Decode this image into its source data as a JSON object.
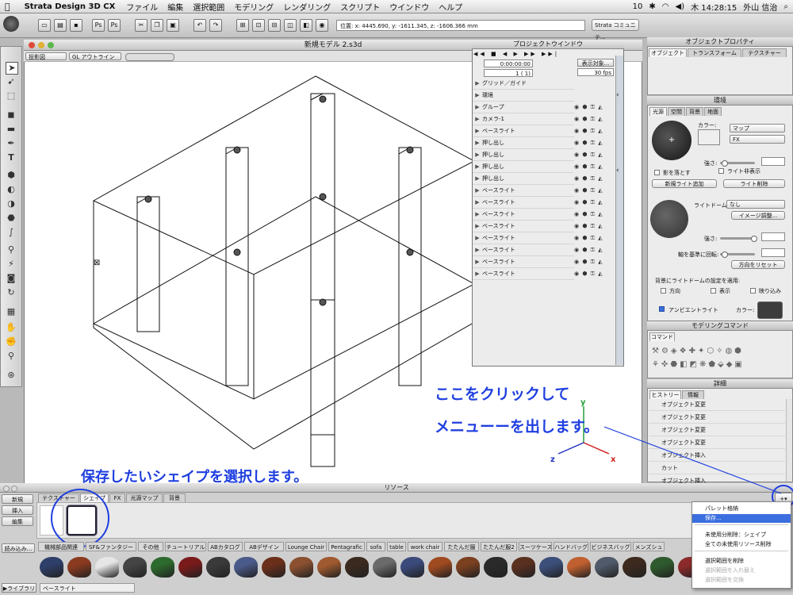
{
  "menubar": {
    "apple": "",
    "app_name": "Strata Design 3D CX",
    "menus": [
      "ファイル",
      "編集",
      "選択範囲",
      "モデリング",
      "レンダリング",
      "スクリプト",
      "ウインドウ",
      "ヘルプ"
    ],
    "status_number": "10",
    "clock": "木 14:28:15",
    "user": "外山 信治"
  },
  "toolbar": {
    "coords": "位置: x: 4445.690, y: -1611.345, z: -1606.366 mm",
    "strata_community": "Strata コミュニテ..."
  },
  "viewport": {
    "title": "新規モデル 2.s3d",
    "projection": "投影図",
    "render_mode": "GL アウトライン",
    "axis_y": "y",
    "axis_x": "x",
    "axis_z": "z"
  },
  "project_window": {
    "title": "プロジェクトウインドウ",
    "timecode": "0:00:00:00",
    "frame": "1 ( 1)",
    "display_objects": "表示対象...",
    "fps": "30 fps",
    "rows": [
      {
        "label": "グリッド／ガイド"
      },
      {
        "label": "環境"
      },
      {
        "label": "グループ"
      },
      {
        "label": "カメラ-1"
      },
      {
        "label": "ベースライト"
      },
      {
        "label": "押し出し"
      },
      {
        "label": "押し出し"
      },
      {
        "label": "押し出し"
      },
      {
        "label": "押し出し"
      },
      {
        "label": "ベースライト"
      },
      {
        "label": "ベースライト"
      },
      {
        "label": "ベースライト"
      },
      {
        "label": "ベースライト"
      },
      {
        "label": "ベースライト"
      },
      {
        "label": "ベースライト"
      },
      {
        "label": "ベースライト"
      },
      {
        "label": "ベースライト"
      }
    ]
  },
  "object_properties": {
    "title": "オブジェクトプロパティ",
    "tabs": [
      "オブジェクト",
      "トランスフォーム",
      "テクスチャー"
    ]
  },
  "environment": {
    "title": "環境",
    "tabs": [
      "光源",
      "空間",
      "背景",
      "地面"
    ],
    "light_plus": "+",
    "color_label": "カラー:",
    "map_dropdown": "マップ",
    "fx_dropdown": "FX",
    "strength_label": "強さ:",
    "shadow_check": "影を落とす",
    "light_hidden_check": "ライト非表示",
    "add_light_button": "新規ライト追加",
    "delete_light_button": "ライト削除",
    "light_dome_label": "ライトドーム:",
    "light_dome_value": "なし",
    "image_adjust_button": "イメージ調整...",
    "strength2_label": "強さ:",
    "rotate_label": "軸を基準に回転:",
    "reset_direction_button": "方向をリセット",
    "bg_dome_label": "背景にライトドームの設定を適用:",
    "direction_check": "方向",
    "display_check": "表示",
    "reflection_check": "映り込み",
    "ambient_check": "アンビエントライト",
    "ambient_color_label": "カラー:"
  },
  "modeling_commands": {
    "title": "モデリングコマンド",
    "tab": "コマンド"
  },
  "details": {
    "title": "詳細",
    "tabs": [
      "ヒストリー",
      "情報"
    ],
    "history": [
      "オブジェクト変更",
      "オブジェクト変更",
      "オブジェクト変更",
      "オブジェクト変更",
      "オブジェクト挿入",
      "カット",
      "オブジェクト挿入"
    ]
  },
  "resources": {
    "title": "リソース",
    "buttons": [
      "新規",
      "挿入",
      "編集"
    ],
    "load_button": "読み込み...",
    "tabs": [
      "テクスチャー",
      "シェイプ",
      "FX",
      "光源マップ",
      "背景"
    ],
    "library_tabs": [
      "機械部品関連",
      "SF&ファンタジー",
      "その他",
      "チュートリアル",
      "ABカタログ",
      "ABデザイン",
      "Lounge Chair",
      "Pentagrafic",
      "sofa",
      "table",
      "work chair",
      "たたんだ服",
      "たたんだ服2",
      "スーツケース",
      "ハンドバッグ",
      "ビジネスバッグ",
      "メンズシュ"
    ],
    "library_button": "▶ライブラリ",
    "footer_dropdown": "ベースライト",
    "shoe_colors": [
      "#2e3f6a",
      "#8a3a1e",
      "#e6e6e6",
      "#444444",
      "#2d6a2d",
      "#7a1a1a",
      "#3a3a3a",
      "#4a5a8a",
      "#6b2f1a",
      "#8a5030",
      "#a05a30",
      "#3b2a20",
      "#6a6a6a",
      "#3a4a7a",
      "#a04a20",
      "#7a4020",
      "#2a2a2a",
      "#5a3020",
      "#3c4f7a",
      "#c06030",
      "#505a6a",
      "#3d2a1f",
      "#2e5a2e",
      "#8a2a2a",
      "#405070",
      "#9a5a2a",
      "#333333",
      "#6a3a20"
    ]
  },
  "context_menu": {
    "items": [
      {
        "label": "パレット格納",
        "state": "normal"
      },
      {
        "label": "保存...",
        "state": "highlight"
      },
      {
        "label": "未使用分削除：シェイプ",
        "state": "normal"
      },
      {
        "label": "全ての未使用リソース削除",
        "state": "normal"
      },
      {
        "label": "選択範囲を削除",
        "state": "normal"
      },
      {
        "label": "選択範囲を入れ替え",
        "state": "disabled"
      },
      {
        "label": "選択範囲を交換",
        "state": "disabled"
      }
    ]
  },
  "annotations": {
    "click_here_line1": "ここをクリックして",
    "click_here_line2": "メニューーを出します。",
    "select_shape": "保存したいシェイプを選択します。"
  },
  "colors": {
    "annotation_blue": "#1f3fe0",
    "menu_highlight": "#3b6fe0",
    "axis_green": "#22a03a",
    "axis_red": "#d02020",
    "axis_blue": "#2030c0"
  }
}
